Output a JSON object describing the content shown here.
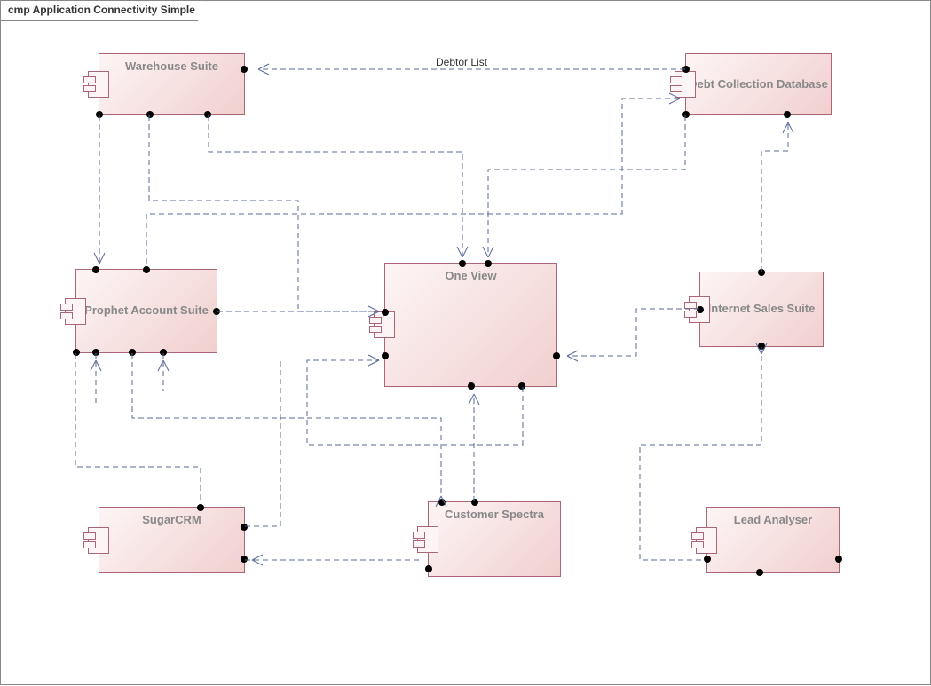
{
  "diagram": {
    "title": "cmp Application Connectivity Simple",
    "label_debtor_list": "Debtor List"
  },
  "components": {
    "warehouse": {
      "label": "Warehouse Suite"
    },
    "debt": {
      "label": "Debt Collection Database"
    },
    "prophet": {
      "label": "Prophet Account Suite"
    },
    "oneview": {
      "label": "One View"
    },
    "internet": {
      "label": "Internet Sales Suite"
    },
    "sugarcrm": {
      "label": "SugarCRM"
    },
    "spectra": {
      "label": "Customer Spectra"
    },
    "lead": {
      "label": "Lead Analyser"
    }
  }
}
